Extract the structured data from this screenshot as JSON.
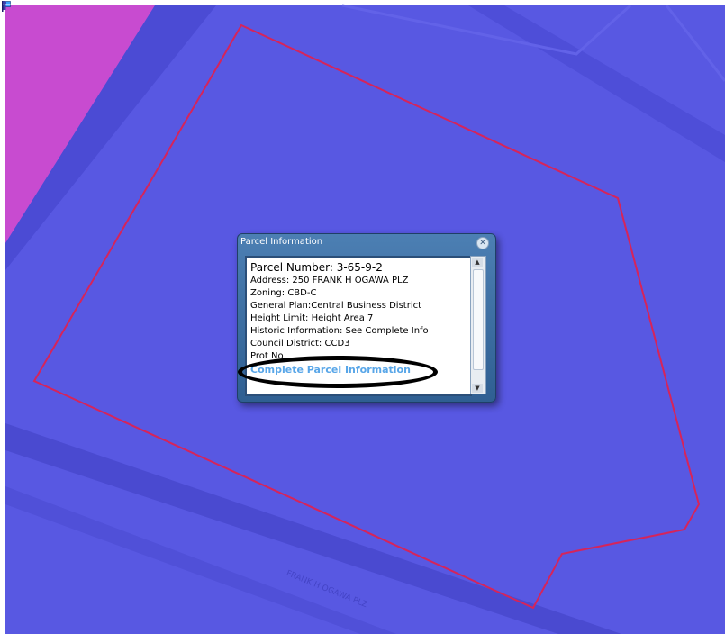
{
  "popup": {
    "title": "Parcel Information",
    "close_icon": "close-icon",
    "parcel_number": "Parcel Number: 3-65-9-2",
    "address": "Address: 250 FRANK H OGAWA PLZ",
    "zoning": "Zoning: CBD-C",
    "general_plan": "General Plan:Central Business District",
    "height_limit": "Height Limit: Height Area 7",
    "historic": "Historic Information: See Complete Info",
    "council_district": "Council District: CCD3",
    "partial_row": "Prot                 No",
    "link_text": "Complete Parcel Information"
  },
  "map": {
    "street_label": "FRANK H OGAWA PLZ",
    "colors": {
      "background": "#5656e0",
      "parcel_outline": "#d6245a",
      "magenta_area": "#c94ad0",
      "street_band": "#4a4ad2",
      "highlight_ellipse": "#000000"
    },
    "icons": [
      "flag-icon",
      "person-icon"
    ]
  }
}
